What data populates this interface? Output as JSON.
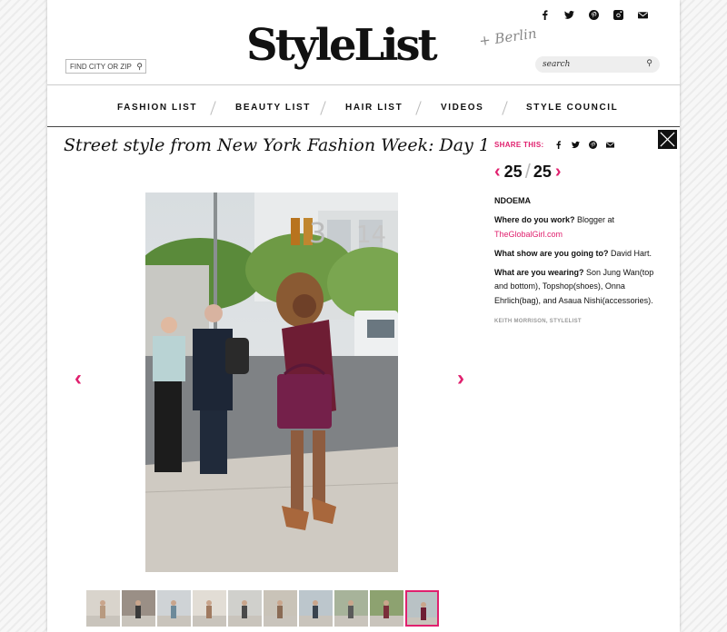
{
  "social": {
    "icons": [
      "facebook-icon",
      "twitter-icon",
      "pinterest-icon",
      "instagram-icon",
      "email-icon"
    ]
  },
  "city_search": {
    "placeholder": "FIND CITY OR ZIP"
  },
  "logo": {
    "text": "StyleList"
  },
  "search": {
    "placeholder": "search"
  },
  "nav": {
    "items": [
      "FASHION LIST",
      "BEAUTY LIST",
      "HAIR LIST",
      "VIDEOS",
      "STYLE COUNCIL"
    ]
  },
  "article": {
    "title": "Street style from New York Fashion Week: Day 1"
  },
  "share": {
    "label": "SHARE THIS:"
  },
  "gallery": {
    "current": "25",
    "total": "25"
  },
  "caption": {
    "name": "NDOEMA",
    "q1": "Where do you work?",
    "a1_pre": " Blogger at ",
    "a1_link": "TheGlobalGirl.com",
    "q2": "What show are you going to?",
    "a2": " David Hart.",
    "q3": "What are you wearing?",
    "a3": " Son Jung Wan(top and bottom), Topshop(shoes), Onna Ehrlich(bag), and Asaua Nishi(accessories).",
    "credit": "KEITH MORRISON, STYLELIST"
  },
  "thumbnails": {
    "count": 10,
    "active_index": 9
  },
  "colors": {
    "accent": "#e0206e",
    "text": "#111111"
  }
}
